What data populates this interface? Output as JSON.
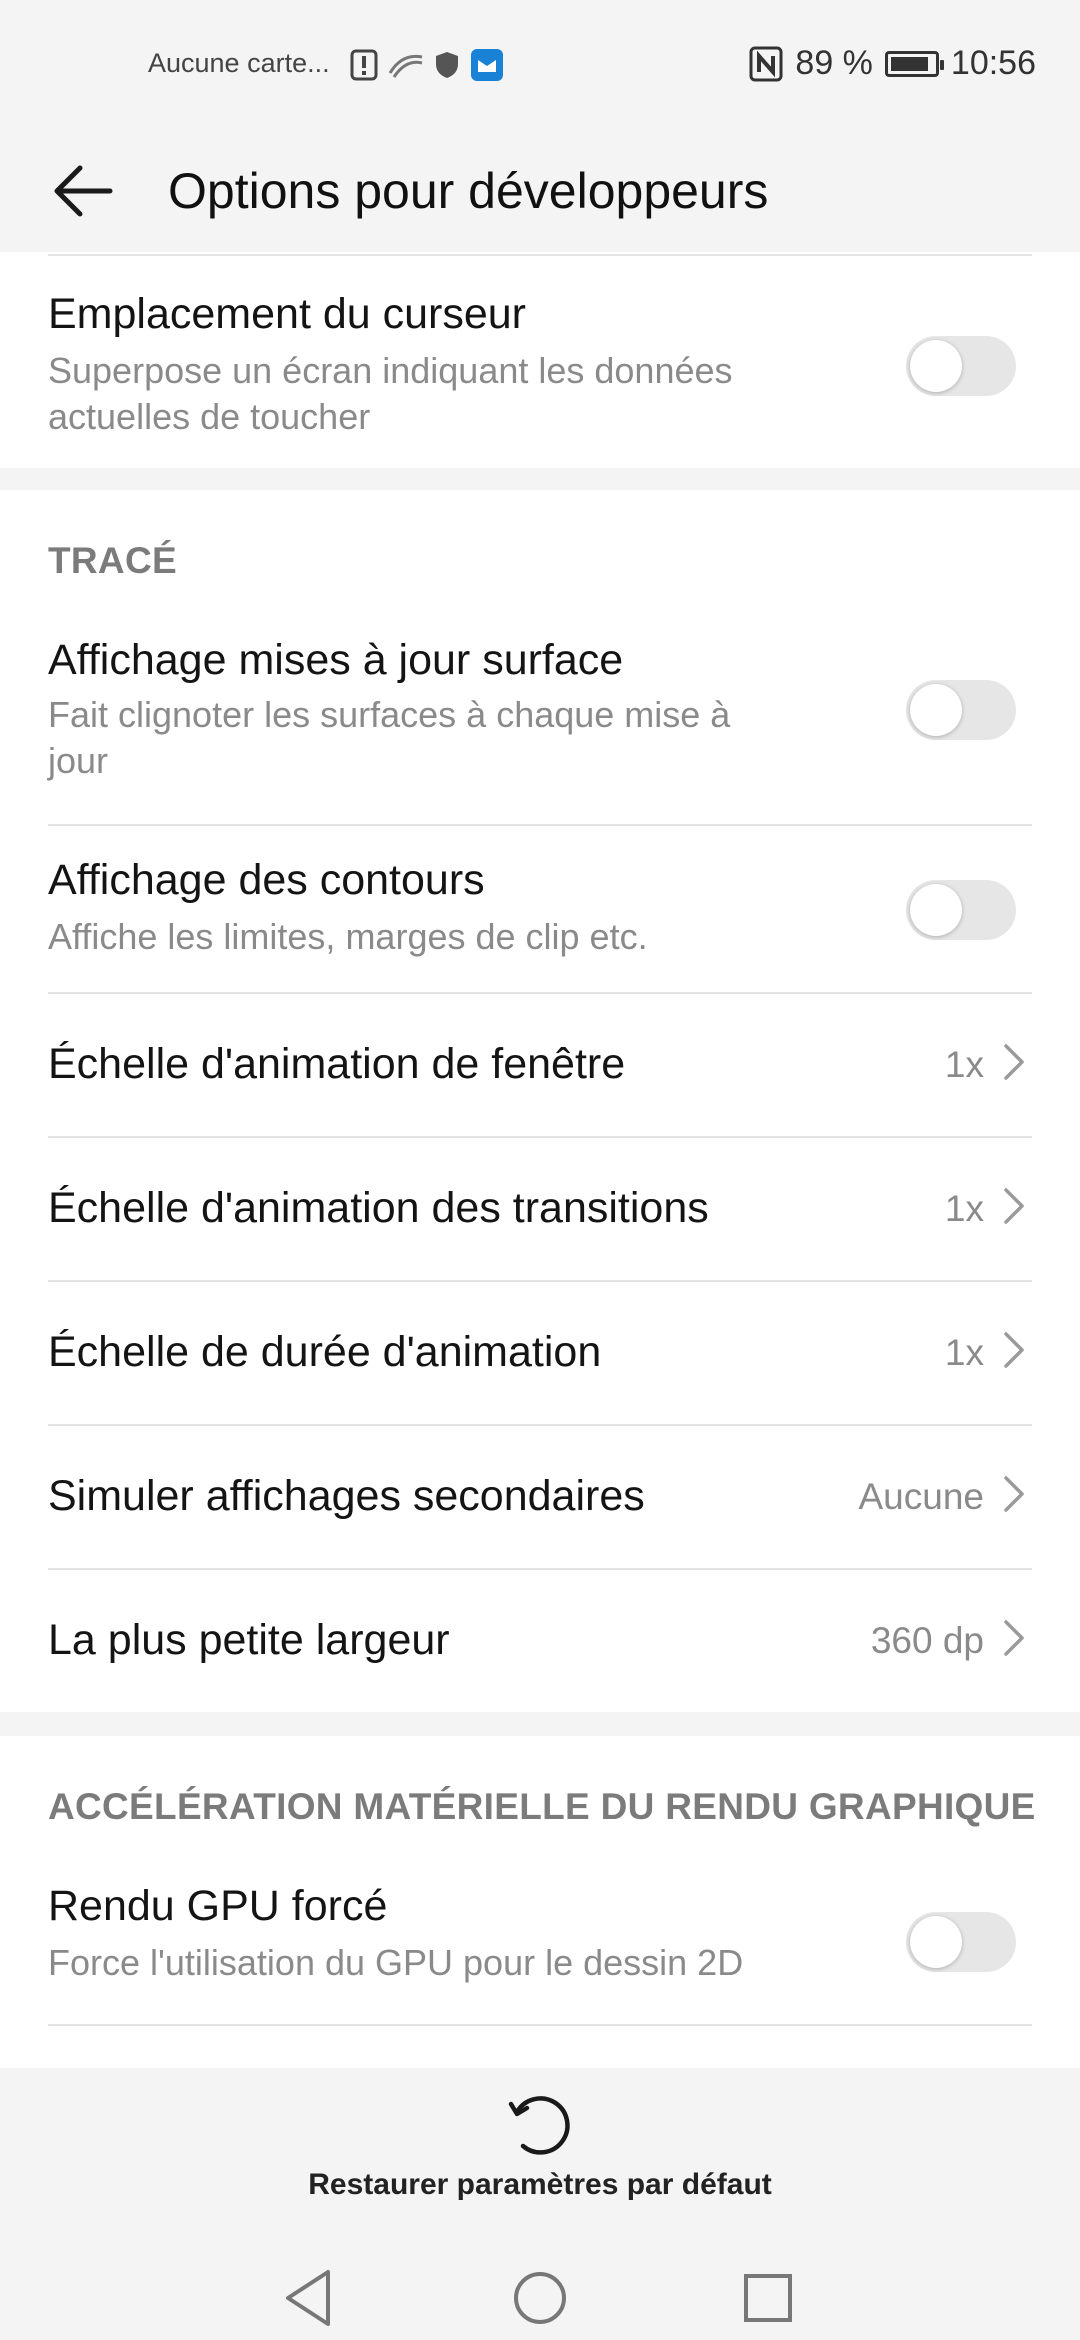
{
  "status_bar": {
    "carrier": "Aucune carte...",
    "battery": "89 %",
    "time": "10:56"
  },
  "header": {
    "title": "Options pour développeurs"
  },
  "items_top": [
    {
      "title": "Emplacement du curseur",
      "subtitle_1": "Superpose un écran indiquant les données",
      "subtitle_2": "actuelles de toucher"
    }
  ],
  "section_trace": {
    "heading": "TRACÉ",
    "surface": {
      "title": "Affichage mises à jour surface",
      "subtitle_1": "Fait clignoter les surfaces à chaque mise à",
      "subtitle_2": "jour"
    },
    "contours": {
      "title": "Affichage des contours",
      "subtitle": "Affiche les limites, marges de clip etc."
    },
    "window_anim": {
      "title": "Échelle d'animation de fenêtre",
      "value": "1x"
    },
    "transition_anim": {
      "title": "Échelle d'animation des transitions",
      "value": "1x"
    },
    "duration_anim": {
      "title": "Échelle de durée d'animation",
      "value": "1x"
    },
    "secondary_displays": {
      "title": "Simuler affichages secondaires",
      "value": "Aucune"
    },
    "smallest_width": {
      "title": "La plus petite largeur",
      "value": "360 dp"
    }
  },
  "section_gpu": {
    "heading": "ACCÉLÉRATION MATÉRIELLE DU RENDU GRAPHIQUE",
    "gpu": {
      "title": "Rendu GPU forcé",
      "subtitle": "Force l'utilisation du GPU pour le dessin 2D"
    }
  },
  "footer": {
    "restore_label": "Restaurer paramètres par défaut"
  },
  "icons": {
    "back": "arrow-left-icon",
    "chevron": "chevron-right-icon",
    "restore": "restore-icon",
    "nav_back": "triangle-back-icon",
    "nav_home": "circle-home-icon",
    "nav_recent": "square-recent-icon"
  },
  "battery_level": 0.89
}
